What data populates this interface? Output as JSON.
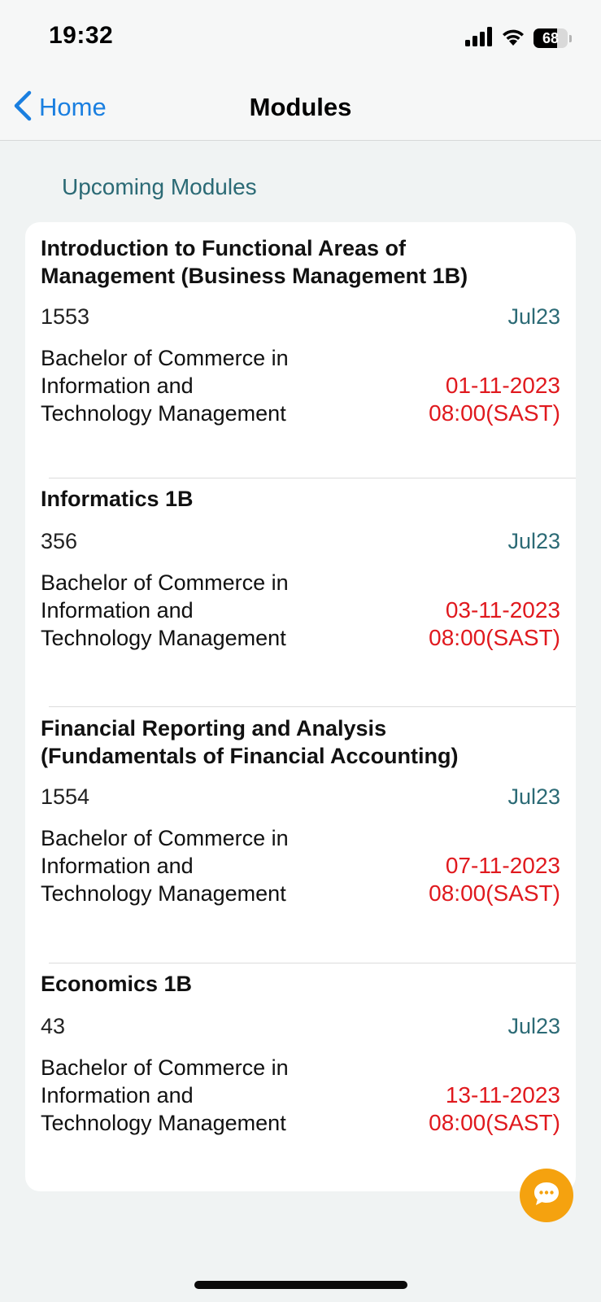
{
  "status_bar": {
    "time": "19:32",
    "battery": "68",
    "icons": [
      "cellular-signal-icon",
      "wifi-icon",
      "battery-icon"
    ]
  },
  "nav": {
    "back_label": "Home",
    "title": "Modules"
  },
  "section_title": "Upcoming Modules",
  "modules": [
    {
      "title": "Introduction to Functional Areas of Management (Business Management 1B)",
      "code": "1553",
      "period": "Jul23",
      "programme": "Bachelor of Commerce in Information and Technology Management",
      "date": "01-11-2023",
      "time": "08:00(SAST)"
    },
    {
      "title": "Informatics 1B",
      "code": "356",
      "period": "Jul23",
      "programme": "Bachelor of Commerce in Information and Technology Management",
      "date": "03-11-2023",
      "time": "08:00(SAST)"
    },
    {
      "title": "Financial Reporting and Analysis (Fundamentals of Financial Accounting)",
      "code": "1554",
      "period": "Jul23",
      "programme": "Bachelor of Commerce in Information and Technology Management",
      "date": "07-11-2023",
      "time": "08:00(SAST)"
    },
    {
      "title": "Economics 1B",
      "code": "43",
      "period": "Jul23",
      "programme": "Bachelor of Commerce in Information and Technology Management",
      "date": "13-11-2023",
      "time": "08:00(SAST)"
    }
  ],
  "colors": {
    "accent": "#1a7fe0",
    "section": "#2b6a75",
    "date": "#e0191e",
    "chat_fab": "#f5a20f"
  }
}
